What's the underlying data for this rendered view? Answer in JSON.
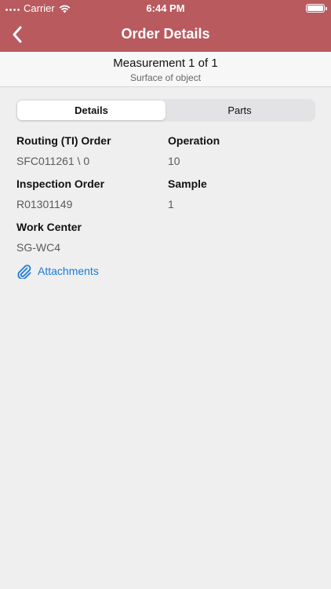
{
  "status_bar": {
    "carrier": "Carrier",
    "time": "6:44 PM"
  },
  "nav": {
    "title": "Order Details",
    "back_icon": "chevron-left-icon"
  },
  "header": {
    "title": "Measurement 1 of 1",
    "subtitle": "Surface of object"
  },
  "tabs": [
    {
      "label": "Details",
      "active": true
    },
    {
      "label": "Parts",
      "active": false
    }
  ],
  "fields": {
    "routing_order": {
      "label": "Routing (TI) Order",
      "value": "SFC011261 \\ 0"
    },
    "operation": {
      "label": "Operation",
      "value": "10"
    },
    "inspection_order": {
      "label": "Inspection Order",
      "value": "R01301149"
    },
    "sample": {
      "label": "Sample",
      "value": "1"
    },
    "work_center": {
      "label": "Work Center",
      "value": "SG-WC4"
    }
  },
  "attachments": {
    "label": "Attachments",
    "icon": "paperclip-icon"
  },
  "colors": {
    "brand": "#b95a5e",
    "link": "#1a7ad9"
  }
}
